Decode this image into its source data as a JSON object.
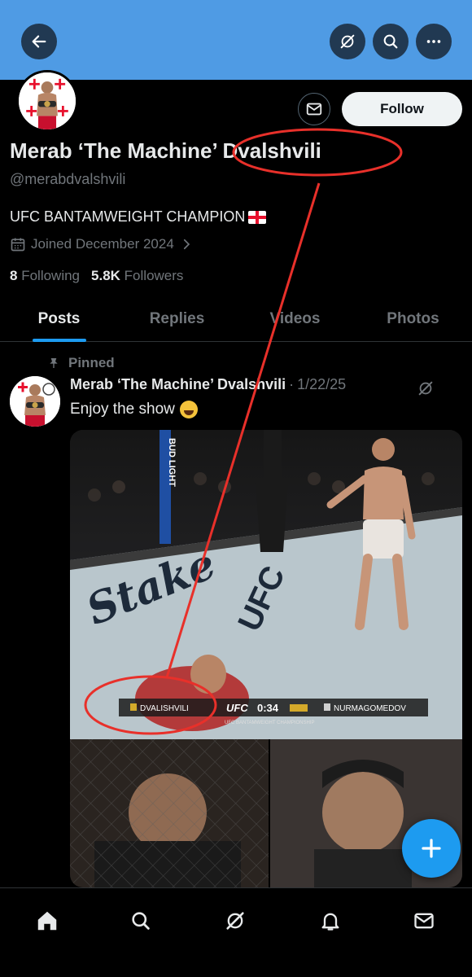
{
  "header": {
    "back_icon": "arrow-left-icon",
    "grok_icon": "grok-icon",
    "search_icon": "search-icon",
    "more_icon": "more-horizontal-icon",
    "banner_color": "#4f9be4"
  },
  "profile": {
    "display_name": "Merab ‘The Machine’ Dvalshvili",
    "handle": "@merabdvalshvili",
    "bio": "UFC BANTAMWEIGHT CHAMPION",
    "bio_flag": "georgia-flag-emoji",
    "joined": "Joined December 2024",
    "following_count": "8",
    "following_label": "Following",
    "followers_count": "5.8K",
    "followers_label": "Followers",
    "follow_label": "Follow",
    "message_icon": "mail-icon"
  },
  "tabs": [
    {
      "label": "Posts",
      "active": true
    },
    {
      "label": "Replies",
      "active": false
    },
    {
      "label": "Videos",
      "active": false
    },
    {
      "label": "Photos",
      "active": false
    }
  ],
  "post": {
    "pinned_label": "Pinned",
    "author": "Merab ‘The Machine’ Dvalshvili",
    "separator": "·",
    "date": "1/22/25",
    "text": "Enjoy the show",
    "emoji": "face-with-tears-of-joy-emoji",
    "media": {
      "banner_left_name": "DVALISHVILI",
      "banner_org": "UFC",
      "banner_time": "0:34",
      "banner_right_name": "NURMAGOMEDOV",
      "banner_subtitle": "UFC BANTAMWEIGHT CHAMPIONSHIP",
      "ring_sponsor": "Stake",
      "cage_sponsor": "BUD LIGHT",
      "mat_logo": "UFC"
    }
  },
  "fab": {
    "icon": "plus-icon"
  },
  "bottom_nav": [
    {
      "icon": "home-icon",
      "active": true
    },
    {
      "icon": "search-icon"
    },
    {
      "icon": "grok-icon"
    },
    {
      "icon": "bell-icon"
    },
    {
      "icon": "mail-icon"
    }
  ],
  "colors": {
    "accent": "#1d9bf0",
    "annotation": "#e8302a",
    "background": "#000000"
  }
}
